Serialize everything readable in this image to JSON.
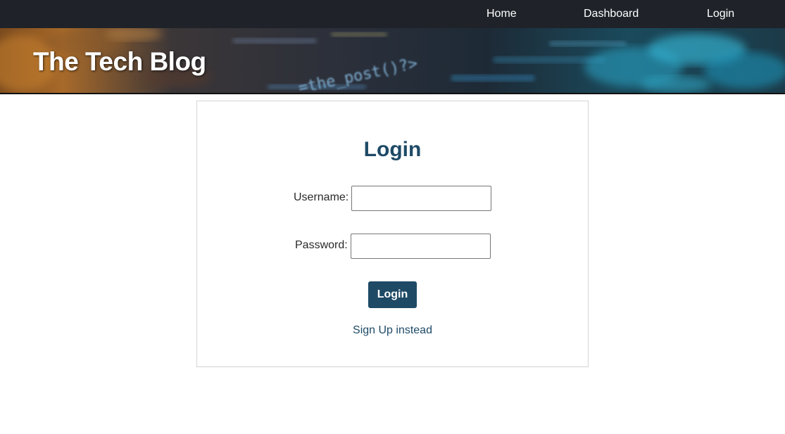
{
  "nav": {
    "items": [
      {
        "label": "Home"
      },
      {
        "label": "Dashboard"
      },
      {
        "label": "Login"
      }
    ]
  },
  "header": {
    "title": "The Tech Blog",
    "banner_code_text": "=the_post()?>"
  },
  "login": {
    "title": "Login",
    "username_label": "Username:",
    "username_value": "",
    "password_label": "Password:",
    "password_value": "",
    "submit_label": "Login",
    "signup_link": "Sign Up instead"
  },
  "colors": {
    "nav_bg": "#1f2329",
    "accent": "#1e4a66",
    "card_border": "#d4d4d4"
  }
}
